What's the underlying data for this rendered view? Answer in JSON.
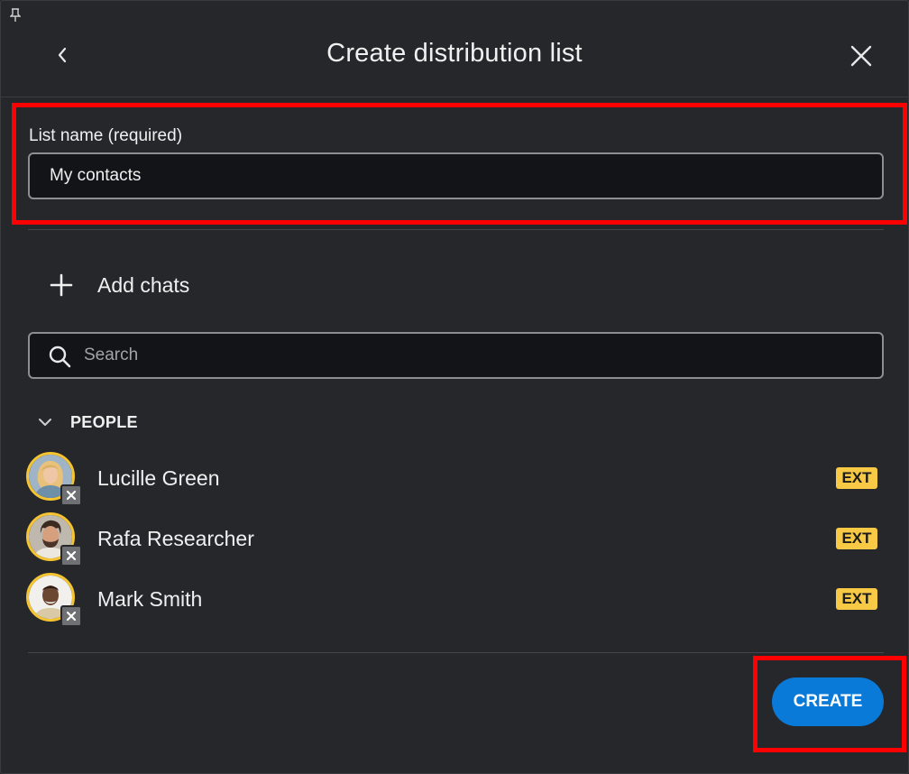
{
  "header": {
    "title": "Create distribution list",
    "back_icon": "chevron-left-icon",
    "close_icon": "close-icon",
    "pin_icon": "pin-icon"
  },
  "list_name": {
    "label": "List name (required)",
    "value": "My contacts"
  },
  "add_chats": {
    "label": "Add chats",
    "icon": "plus-icon"
  },
  "search": {
    "placeholder": "Search",
    "value": ""
  },
  "people_section": {
    "title": "PEOPLE",
    "collapsed": false,
    "items": [
      {
        "name": "Lucille Green",
        "badge": "EXT",
        "presence": "offline"
      },
      {
        "name": "Rafa Researcher",
        "badge": "EXT",
        "presence": "offline"
      },
      {
        "name": "Mark Smith",
        "badge": "EXT",
        "presence": "offline"
      }
    ]
  },
  "footer": {
    "create_label": "CREATE"
  },
  "colors": {
    "background": "#26272b",
    "input_background": "#131417",
    "accent": "#0a7ad8",
    "external_badge": "#f7c944",
    "avatar_ring": "#f5c431",
    "highlight": "#ff0000"
  }
}
